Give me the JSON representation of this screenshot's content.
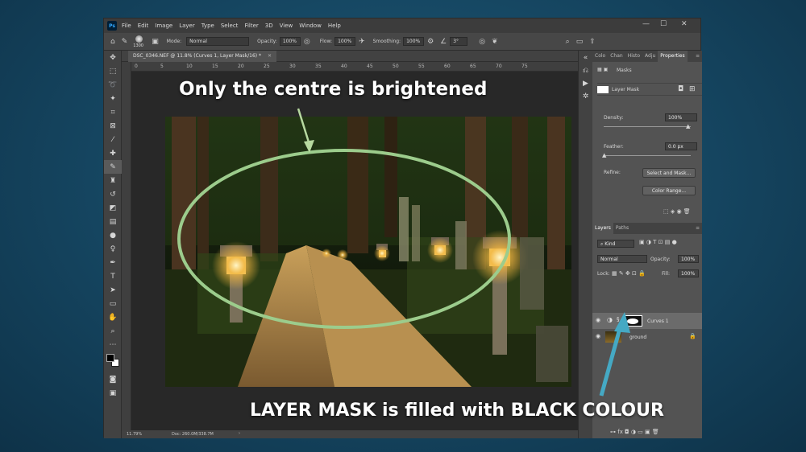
{
  "menu": {
    "items": [
      "File",
      "Edit",
      "Image",
      "Layer",
      "Type",
      "Select",
      "Filter",
      "3D",
      "View",
      "Window",
      "Help"
    ],
    "logo": "Ps"
  },
  "options": {
    "brush_size": "1300",
    "mode_label": "Mode:",
    "mode_value": "Normal",
    "opacity_label": "Opacity:",
    "opacity_value": "100%",
    "flow_label": "Flow:",
    "flow_value": "100%",
    "smoothing_label": "Smoothing:",
    "smoothing_value": "100%",
    "angle_value": "3°"
  },
  "document": {
    "tab_title": "DSC_0346.NEF @ 11.8% (Curves 1, Layer Mask/16) *",
    "ruler_ticks": [
      "0",
      "5",
      "10",
      "15",
      "20",
      "25",
      "30",
      "35",
      "40",
      "45",
      "50",
      "55",
      "60",
      "65",
      "70",
      "75"
    ]
  },
  "status": {
    "zoom": "11.79%",
    "doc_size": "Doc: 260.0M/338.7M"
  },
  "properties": {
    "tabs": [
      "Colo",
      "Chan",
      "Histo",
      "Adju",
      "Properties"
    ],
    "masks_label": "Masks",
    "layer_mask_label": "Layer Mask",
    "density_label": "Density:",
    "density_value": "100%",
    "density_level": 1.0,
    "feather_label": "Feather:",
    "feather_value": "0.0 px",
    "feather_level": 0.0,
    "refine_label": "Refine:",
    "select_mask_button": "Select and Mask...",
    "color_range_button": "Color Range..."
  },
  "layers": {
    "tabs": [
      "Layers",
      "Paths"
    ],
    "kind_label": "Kind",
    "blend_mode": "Normal",
    "opacity_label": "Opacity:",
    "opacity_value": "100%",
    "lock_label": "Lock:",
    "fill_label": "Fill:",
    "fill_value": "100%",
    "items": [
      {
        "name": "Curves 1"
      },
      {
        "name": "ground"
      }
    ]
  },
  "annotations": {
    "top": "Only the centre is brightened",
    "bottom": "LAYER MASK is filled with BLACK COLOUR"
  },
  "colors": {
    "annotation_ellipse": "#9ccc8c",
    "annotation_arrow_top": "#b7d9a0",
    "annotation_arrow_bottom": "#45a9c4"
  }
}
